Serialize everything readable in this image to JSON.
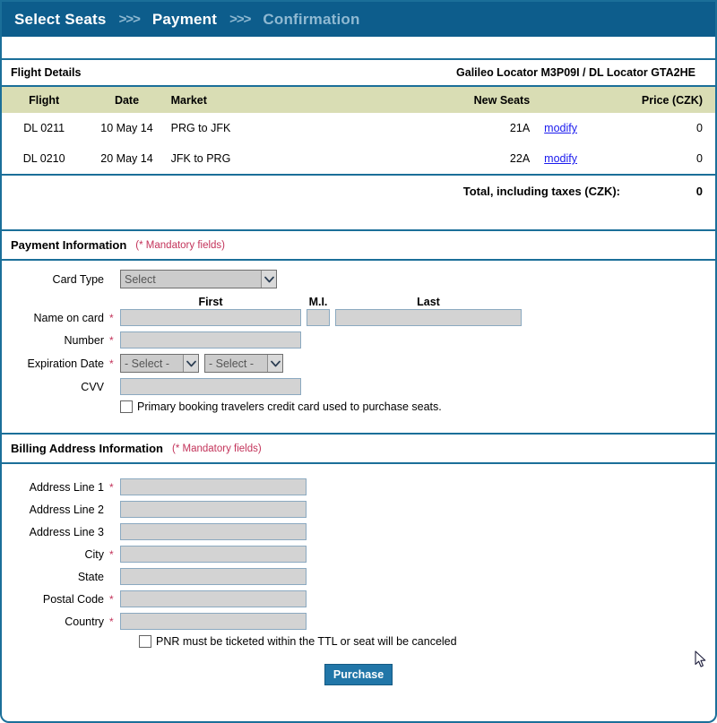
{
  "nav": {
    "steps": [
      {
        "label": "Select Seats",
        "state": "done"
      },
      {
        "label": "Payment",
        "state": "current"
      },
      {
        "label": "Confirmation",
        "state": "upcoming"
      }
    ],
    "separator": ">>>"
  },
  "flight_details": {
    "title": "Flight Details",
    "locator": "Galileo Locator M3P09I / DL Locator GTA2HE",
    "columns": {
      "flight": "Flight",
      "date": "Date",
      "market": "Market",
      "new_seats": "New Seats",
      "price": "Price (CZK)"
    },
    "rows": [
      {
        "flight": "DL 0211",
        "date": "10 May 14",
        "market": "PRG to JFK",
        "new_seats": "21A",
        "modify": "modify",
        "price": "0"
      },
      {
        "flight": "DL 0210",
        "date": "20 May 14",
        "market": "JFK to PRG",
        "new_seats": "22A",
        "modify": "modify",
        "price": "0"
      }
    ],
    "total_label": "Total, including taxes (CZK):",
    "total_value": "0"
  },
  "payment": {
    "title": "Payment Information",
    "mandatory_note": "(* Mandatory fields)",
    "card_type": {
      "label": "Card Type",
      "value": "Select",
      "required": false
    },
    "name_on_card": {
      "label": "Name on card",
      "required": true,
      "first_header": "First",
      "mi_header": "M.I.",
      "last_header": "Last",
      "first_value": "",
      "mi_value": "",
      "last_value": ""
    },
    "number": {
      "label": "Number",
      "required": true,
      "value": ""
    },
    "expiration": {
      "label": "Expiration Date",
      "required": true,
      "month_value": "- Select -",
      "year_value": "- Select -"
    },
    "cvv": {
      "label": "CVV",
      "required": false,
      "value": ""
    },
    "primary_checkbox": {
      "label": "Primary booking travelers credit card used to purchase seats.",
      "checked": false
    }
  },
  "billing": {
    "title": "Billing Address Information",
    "mandatory_note": "(* Mandatory fields)",
    "fields": [
      {
        "label": "Address Line 1",
        "required": true,
        "value": ""
      },
      {
        "label": "Address Line 2",
        "required": false,
        "value": ""
      },
      {
        "label": "Address Line 3",
        "required": false,
        "value": ""
      },
      {
        "label": "City",
        "required": true,
        "value": ""
      },
      {
        "label": "State",
        "required": false,
        "value": ""
      },
      {
        "label": "Postal Code",
        "required": true,
        "value": ""
      },
      {
        "label": "Country",
        "required": true,
        "value": ""
      }
    ],
    "ttl_checkbox": {
      "label": "PNR must be ticketed within the TTL or seat will be canceled",
      "checked": false
    }
  },
  "actions": {
    "purchase_label": "Purchase"
  },
  "colors": {
    "nav_background": "#0d5d8c",
    "frame_border": "#1b6f99",
    "table_header": "#d9ddb4",
    "required_mark": "#c3335a",
    "link": "#1a1aee",
    "button": "#2176a8",
    "input_background": "#d3d3d3"
  },
  "required_mark": "*"
}
